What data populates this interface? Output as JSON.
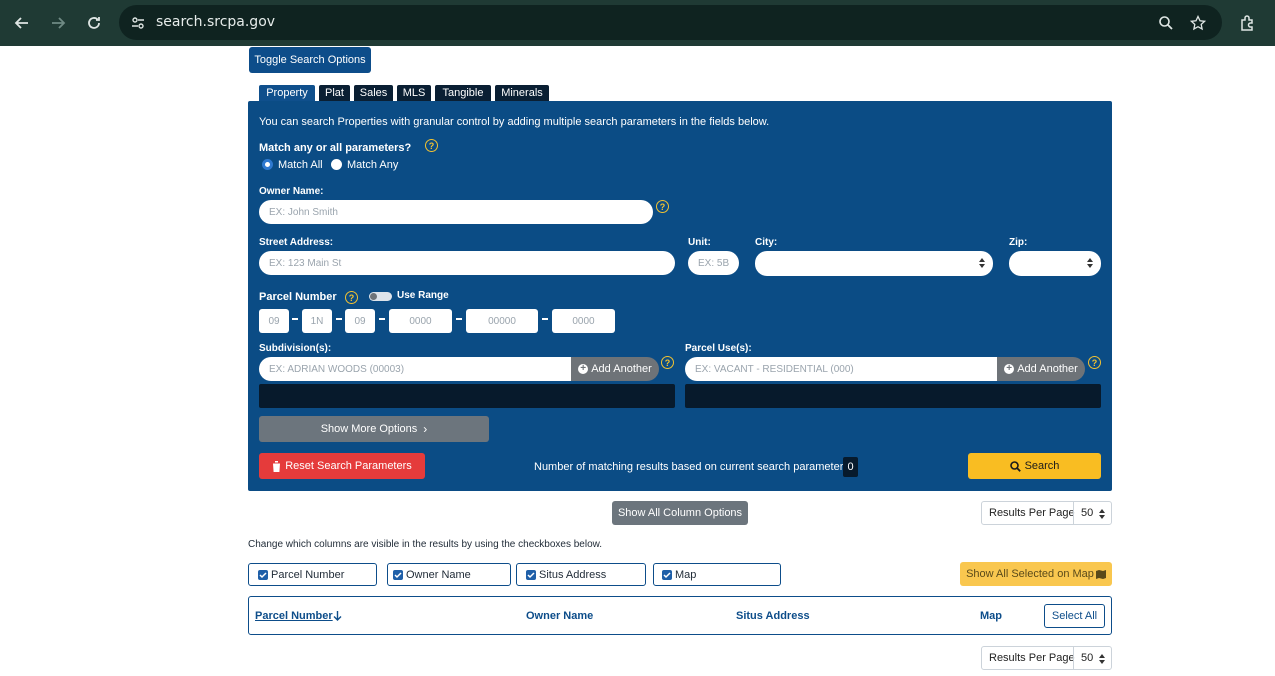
{
  "browser": {
    "url": "search.srcpa.gov",
    "colors": {
      "chrome": "#1f3a34",
      "omnibox": "#0f2320"
    }
  },
  "toggle_button": "Toggle Search Options",
  "tabs": [
    "Property",
    "Plat",
    "Sales",
    "MLS",
    "Tangible",
    "Minerals"
  ],
  "panel": {
    "intro": "You can search Properties with granular control by adding multiple search parameters in the fields below.",
    "match_label": "Match any or all parameters?",
    "match_all": "Match All",
    "match_any": "Match Any",
    "owner_label": "Owner Name:",
    "owner_placeholder": "EX: John Smith",
    "street_label": "Street Address:",
    "street_placeholder": "EX: 123 Main St",
    "unit_label": "Unit:",
    "unit_placeholder": "EX: 5B",
    "city_label": "City:",
    "zip_label": "Zip:",
    "parcel_label": "Parcel Number",
    "use_range": "Use Range",
    "parcel_segments": [
      "09",
      "1N",
      "09",
      "0000",
      "00000",
      "0000"
    ],
    "subdivision_label": "Subdivision(s):",
    "subdivision_placeholder": "EX: ADRIAN WOODS (00003)",
    "parcel_use_label": "Parcel Use(s):",
    "parcel_use_placeholder": "EX: VACANT - RESIDENTIAL (000)",
    "add_another": "Add Another",
    "show_more": "Show More Options",
    "reset": "Reset Search Parameters",
    "results_text": "Number of matching results based on current search parameters:",
    "results_count": "0",
    "search": "Search",
    "help_glyph": "?",
    "colors": {
      "panel": "#0b4c85",
      "reset": "#e53b3b",
      "search": "#f9bd22"
    }
  },
  "columns_section": {
    "show_all_columns": "Show All Column Options",
    "results_per_page_label": "Results Per Page",
    "results_per_page_value": "50",
    "instructions": "Change which columns are visible in the results by using the checkboxes below.",
    "checkboxes": [
      "Parcel Number",
      "Owner Name",
      "Situs Address",
      "Map"
    ],
    "show_on_map": "Show All Selected on Map"
  },
  "table": {
    "headers": [
      "Parcel Number",
      "Owner Name",
      "Situs Address",
      "Map"
    ],
    "select_all": "Select All"
  },
  "footer": {
    "results_per_page_label": "Results Per Page",
    "results_per_page_value": "50"
  }
}
